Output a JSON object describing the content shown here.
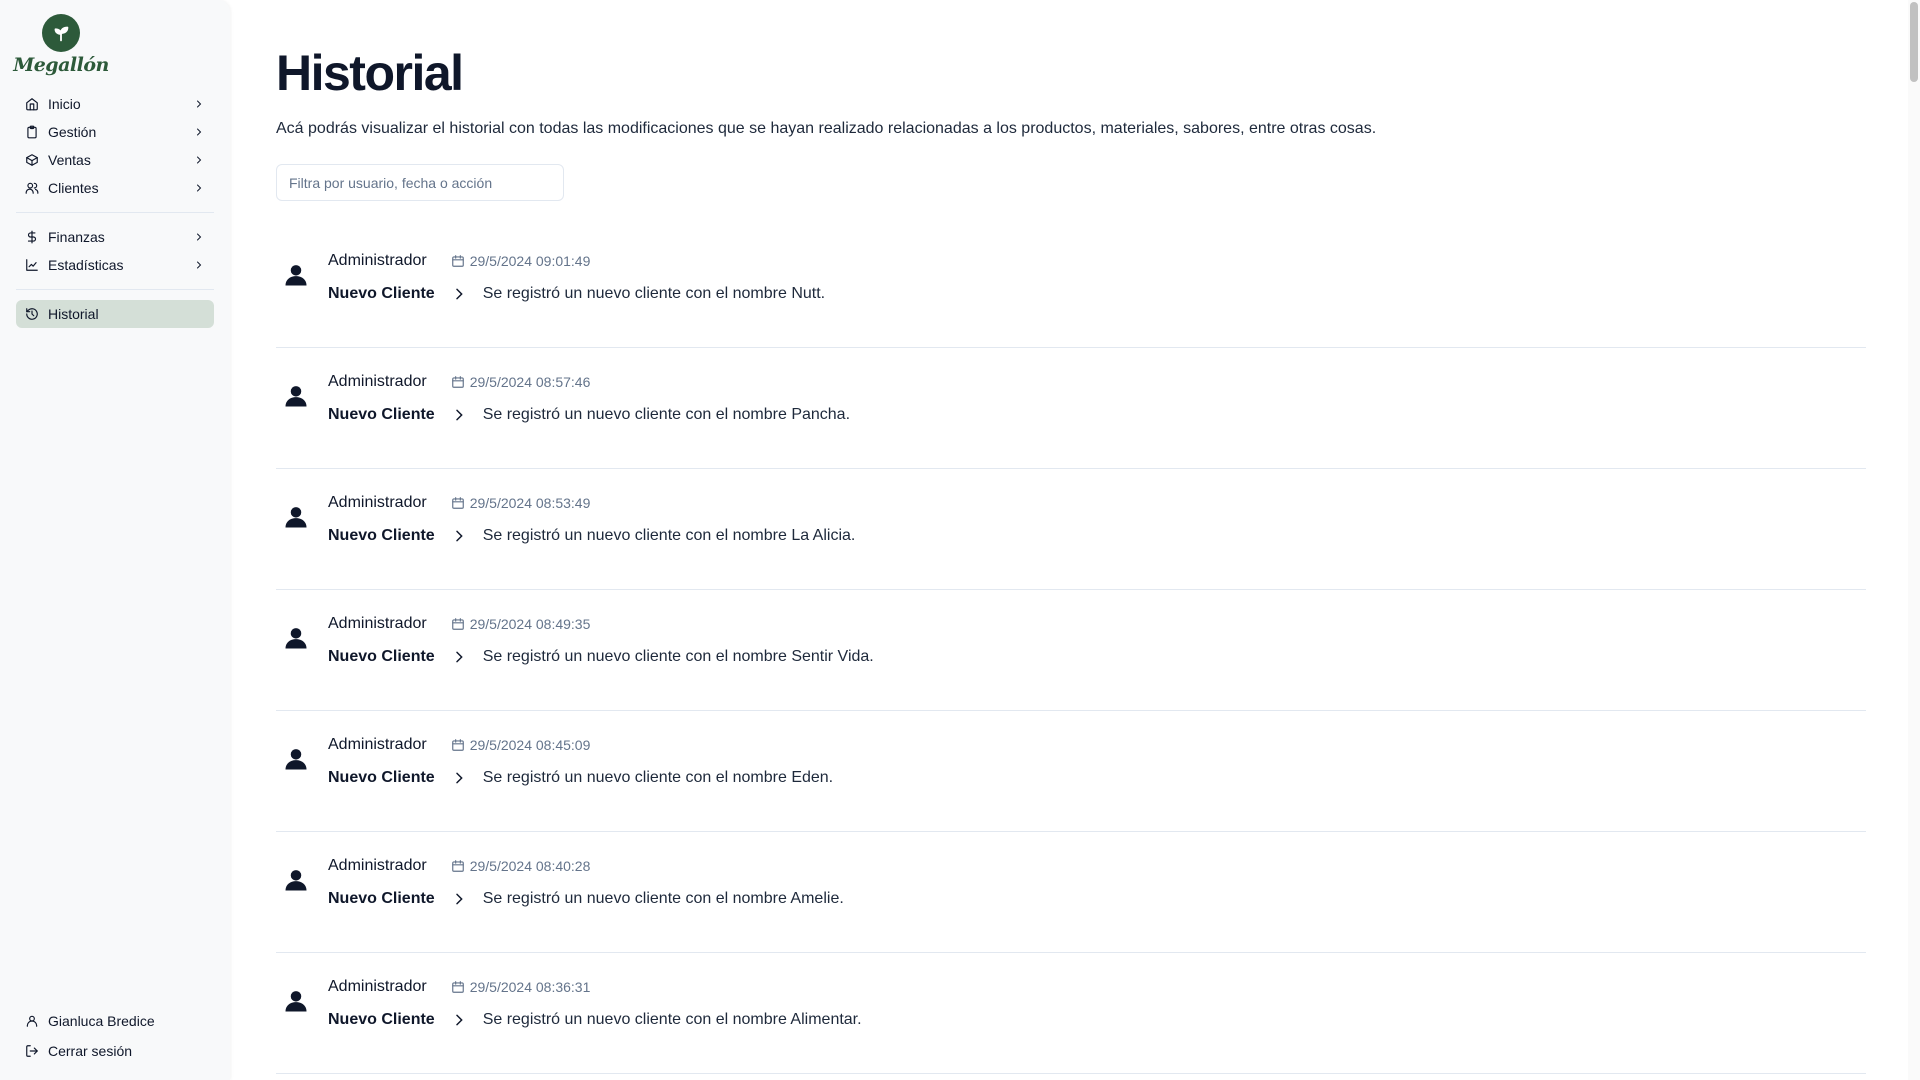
{
  "brand": {
    "name": "Megallón",
    "color": "#2d5a3a"
  },
  "sidebar": {
    "groups": [
      [
        {
          "label": "Inicio",
          "icon": "home-icon"
        },
        {
          "label": "Gestión",
          "icon": "clipboard-icon"
        },
        {
          "label": "Ventas",
          "icon": "package-icon"
        },
        {
          "label": "Clientes",
          "icon": "users-icon"
        }
      ],
      [
        {
          "label": "Finanzas",
          "icon": "dollar-icon"
        },
        {
          "label": "Estadísticas",
          "icon": "chart-icon"
        }
      ],
      [
        {
          "label": "Historial",
          "icon": "history-icon",
          "active": true
        }
      ]
    ],
    "footer": {
      "user_name": "Gianluca Bredice",
      "logout_label": "Cerrar sesión"
    }
  },
  "main": {
    "title": "Historial",
    "description": "Acá podrás visualizar el historial con todas las modificaciones que se hayan realizado relacionadas a los productos, materiales, sabores, entre otras cosas.",
    "filter_placeholder": "Filtra por usuario, fecha o acción",
    "entries": [
      {
        "user": "Administrador",
        "date": "29/5/2024 09:01:49",
        "action": "Nuevo Cliente",
        "detail": "Se registró un nuevo cliente con el nombre Nutt."
      },
      {
        "user": "Administrador",
        "date": "29/5/2024 08:57:46",
        "action": "Nuevo Cliente",
        "detail": "Se registró un nuevo cliente con el nombre Pancha."
      },
      {
        "user": "Administrador",
        "date": "29/5/2024 08:53:49",
        "action": "Nuevo Cliente",
        "detail": "Se registró un nuevo cliente con el nombre La Alicia."
      },
      {
        "user": "Administrador",
        "date": "29/5/2024 08:49:35",
        "action": "Nuevo Cliente",
        "detail": "Se registró un nuevo cliente con el nombre Sentir Vida."
      },
      {
        "user": "Administrador",
        "date": "29/5/2024 08:45:09",
        "action": "Nuevo Cliente",
        "detail": "Se registró un nuevo cliente con el nombre Eden."
      },
      {
        "user": "Administrador",
        "date": "29/5/2024 08:40:28",
        "action": "Nuevo Cliente",
        "detail": "Se registró un nuevo cliente con el nombre Amelie."
      },
      {
        "user": "Administrador",
        "date": "29/5/2024 08:36:31",
        "action": "Nuevo Cliente",
        "detail": "Se registró un nuevo cliente con el nombre Alimentar."
      }
    ]
  }
}
